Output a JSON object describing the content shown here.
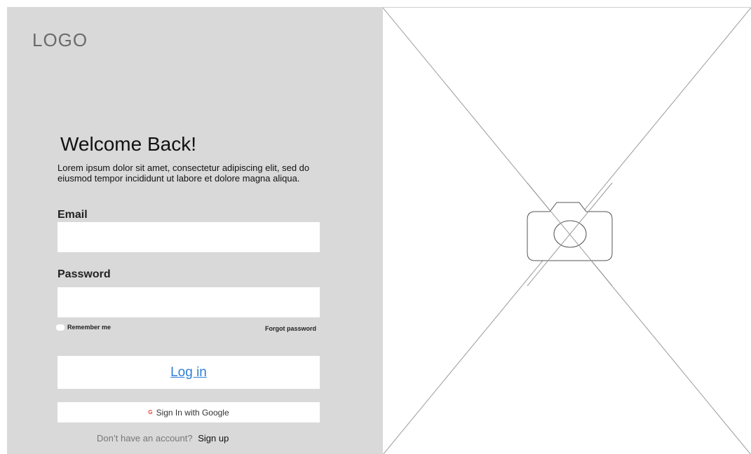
{
  "logo": {
    "text": "LOGO"
  },
  "login": {
    "title": "Welcome Back!",
    "subtitle": "Lorem ipsum dolor sit amet, consectetur adipiscing elit, sed do eiusmod tempor incididunt ut labore et dolore magna aliqua.",
    "email_label": "Email",
    "email_value": "",
    "password_label": "Password",
    "password_value": "",
    "remember_label": "Remember me",
    "forgot_label": "Forgot password",
    "login_button": "Log in",
    "google_button": "Sign In with Google",
    "signup_prompt": "Don’t have an account?",
    "signup_link": "Sign up"
  },
  "image_placeholder": {
    "icon": "camera-icon"
  },
  "colors": {
    "panel_bg": "#d9d9d9",
    "link_blue": "#2f7ed8"
  }
}
